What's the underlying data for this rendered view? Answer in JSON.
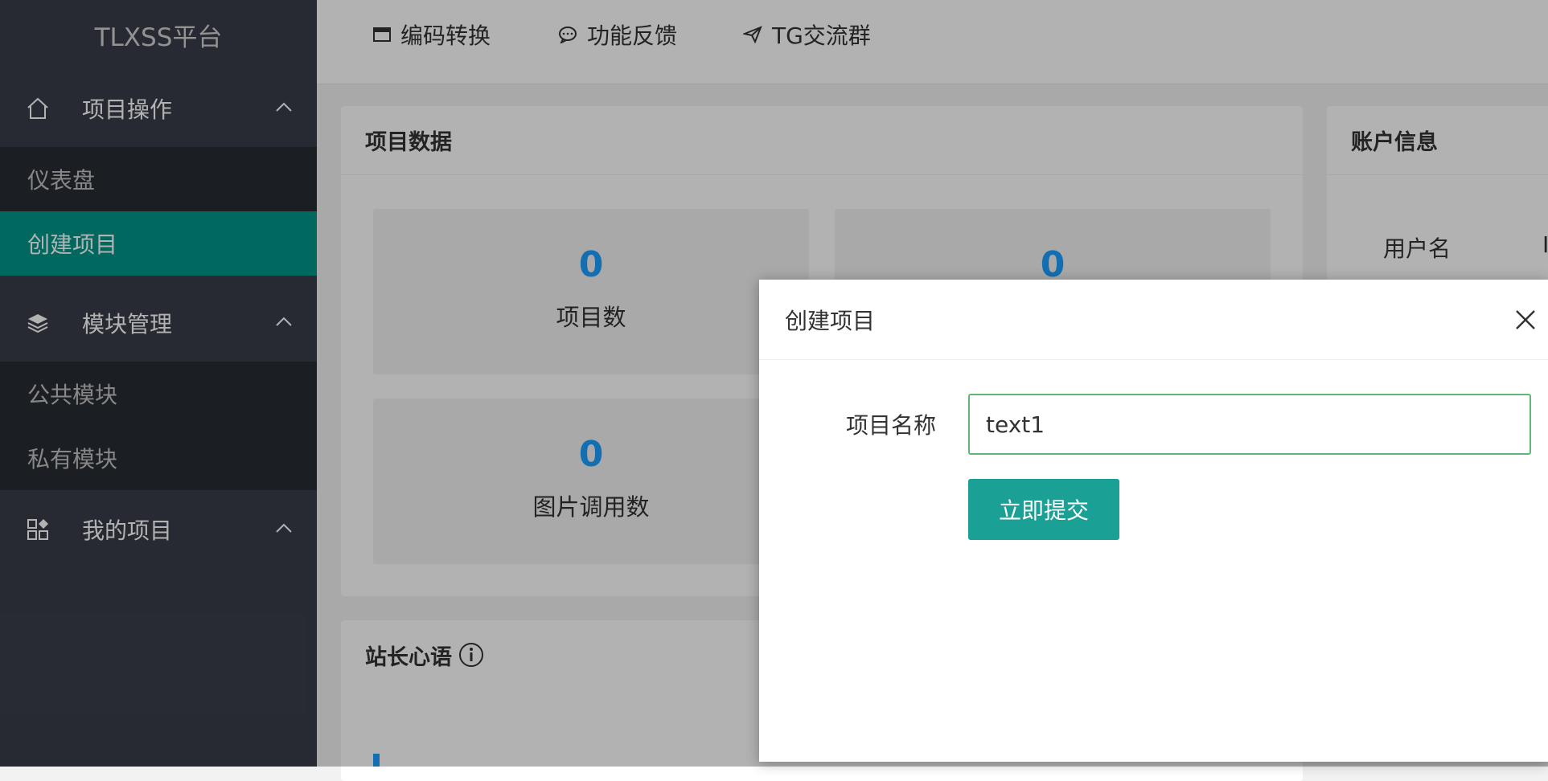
{
  "app": {
    "logo": "TLXSS平台"
  },
  "sidebar": {
    "groups": [
      {
        "label": "项目操作",
        "icon": "home-icon",
        "items": [
          "仪表盘",
          "创建项目"
        ],
        "active": "创建项目"
      },
      {
        "label": "模块管理",
        "icon": "layers-icon",
        "items": [
          "公共模块",
          "私有模块"
        ]
      },
      {
        "label": "我的项目",
        "icon": "apps-icon",
        "items": []
      }
    ]
  },
  "header": {
    "links": [
      {
        "label": "编码转换",
        "icon": "window-icon"
      },
      {
        "label": "功能反馈",
        "icon": "chat-icon"
      },
      {
        "label": "TG交流群",
        "icon": "send-icon"
      }
    ]
  },
  "main": {
    "project_panel": {
      "title": "项目数据",
      "stats": [
        {
          "value": "0",
          "label": "项目数"
        },
        {
          "value": "0",
          "label": ""
        },
        {
          "value": "0",
          "label": "图片调用数"
        }
      ]
    },
    "account_panel": {
      "title": "账户信息",
      "username_label": "用户名",
      "username_value_partial": "I"
    },
    "notice_panel": {
      "title": "站长心语"
    }
  },
  "modal": {
    "title": "创建项目",
    "field_label": "项目名称",
    "field_value": "text1",
    "submit_label": "立即提交"
  },
  "colors": {
    "sidebar_bg": "#393d49",
    "active": "#009688",
    "stat_num": "#1e9fff",
    "submit": "#1aa094"
  }
}
